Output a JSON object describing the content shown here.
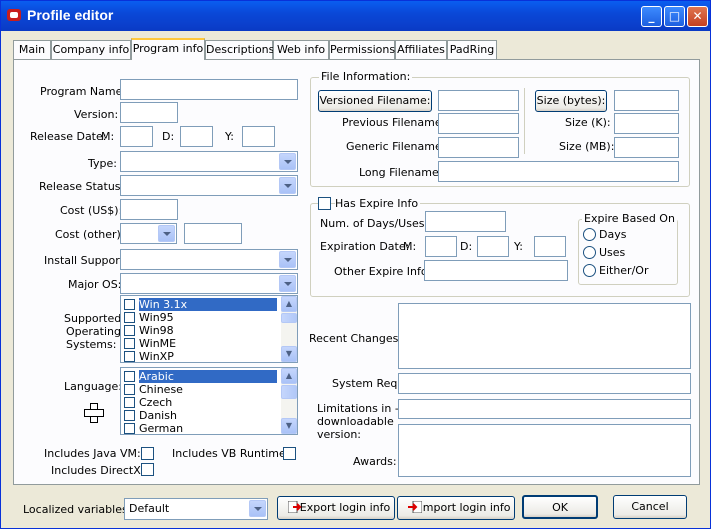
{
  "window": {
    "title": "Profile editor"
  },
  "tabs": [
    {
      "label": "Main"
    },
    {
      "label": "Company info"
    },
    {
      "label": "Program info"
    },
    {
      "label": "Descriptions"
    },
    {
      "label": "Web info"
    },
    {
      "label": "Permissions"
    },
    {
      "label": "Affiliates"
    },
    {
      "label": "PadRing"
    }
  ],
  "active_tab": "Program info",
  "left": {
    "program_name_label": "Program Name:",
    "version_label": "Version:",
    "release_date_label": "Release Date:",
    "m_label": "M:",
    "d_label": "D:",
    "y_label": "Y:",
    "type_label": "Type:",
    "release_status_label": "Release Status:",
    "cost_usd_label": "Cost (US$):",
    "cost_other_label": "Cost (other):",
    "install_support_label": "Install Support:",
    "major_os_label": "Major OS:",
    "supported_os_label_1": "Supported",
    "supported_os_label_2": "Operating",
    "supported_os_label_3": "Systems:",
    "os_list": [
      "Win 3.1x",
      "Win95",
      "Win98",
      "WinME",
      "WinXP"
    ],
    "language_label": "Language:",
    "language_list": [
      "Arabic",
      "Chinese",
      "Czech",
      "Danish",
      "German"
    ],
    "java_vm_label": "Includes Java VM:",
    "vb_runtime_label": "Includes VB Runtime:",
    "directx_label": "Includes DirectX:"
  },
  "file_info": {
    "group_title": "File Information:",
    "versioned_filename_button": "Versioned Filename:",
    "previous_filename_label": "Previous Filename:",
    "generic_filename_label": "Generic Filename:",
    "long_filename_label": "Long Filename:",
    "size_bytes_button": "Size (bytes):",
    "size_k_label": "Size (K):",
    "size_mb_label": "Size (MB):"
  },
  "expire": {
    "has_expire_label": "Has Expire Info",
    "num_days_label": "Num. of Days/Uses:",
    "expiration_date_label": "Expiration Date:",
    "m_label": "M:",
    "d_label": "D:",
    "y_label": "Y:",
    "other_expire_label": "Other Expire Info:",
    "based_on_title": "Expire Based On",
    "options": [
      "Days",
      "Uses",
      "Either/Or"
    ]
  },
  "right_lower": {
    "recent_changes_label": "Recent Changes:",
    "system_req_label": "System Req:",
    "limitations_label_1": "Limitations in ----",
    "limitations_label_2": "downloadable",
    "limitations_label_3": "version:",
    "awards_label": "Awards:"
  },
  "bottom": {
    "localized_label": "Localized variables",
    "localized_value": "Default",
    "export_button": "Export login info",
    "import_button": "Import login info",
    "ok_button": "OK",
    "cancel_button": "Cancel"
  },
  "colors": {
    "titlebar": "#0a48d8",
    "selection": "#316ac5",
    "panel_bg": "#fcfcfe",
    "window_bg": "#ece9d8"
  }
}
